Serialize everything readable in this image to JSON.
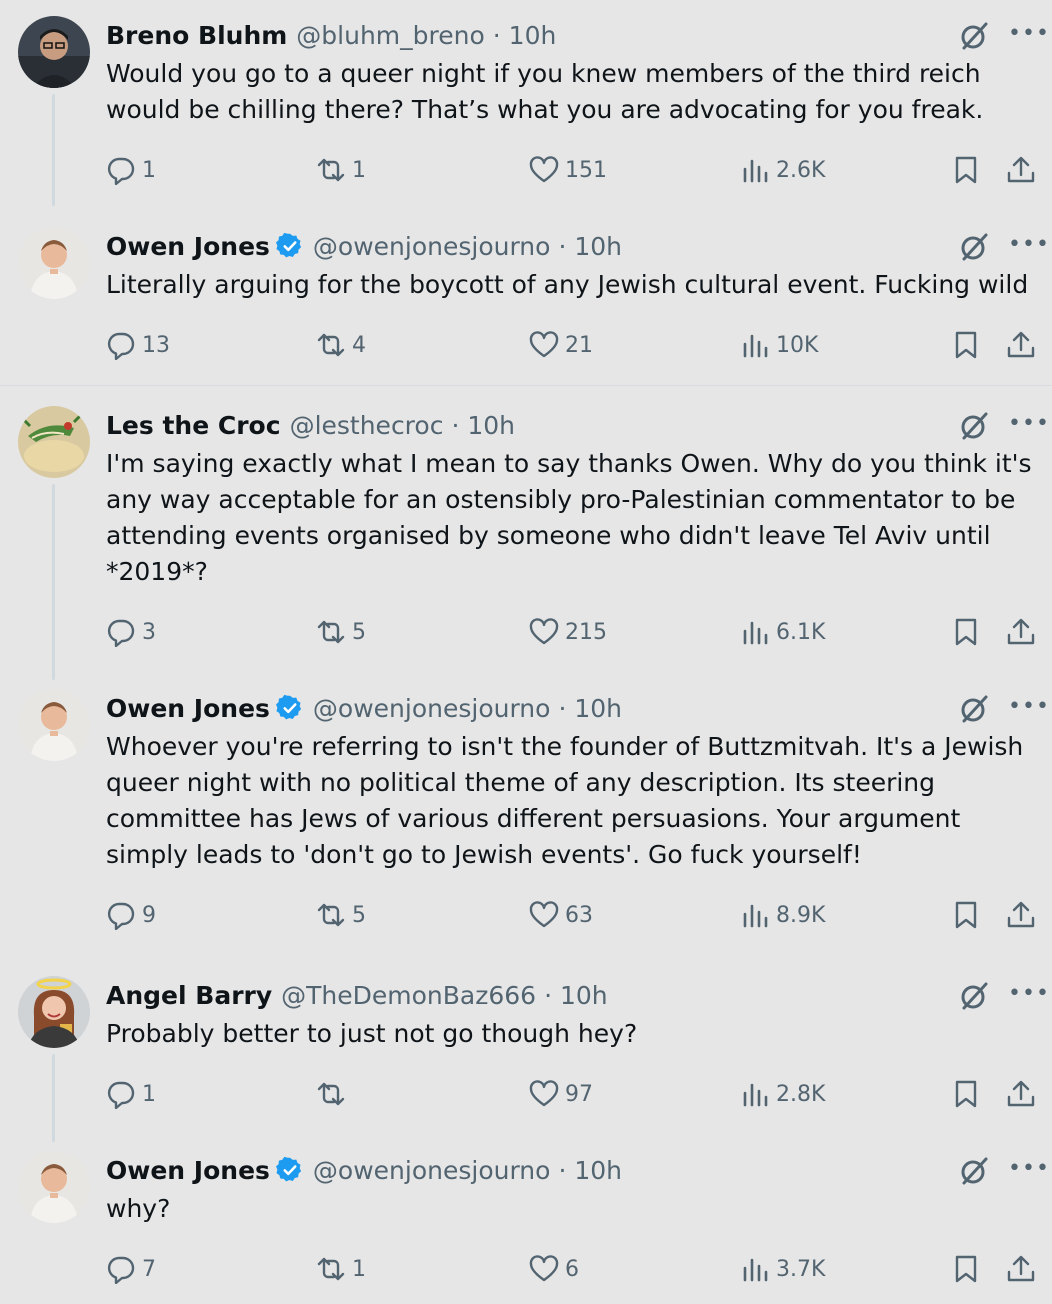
{
  "tweets": [
    {
      "name": "Breno Bluhm",
      "handle": "@bluhm_breno",
      "time": "· 10h",
      "verified": false,
      "avatar": "avatar-photo",
      "text": "Would you go to a queer night if you knew members of the third reich would be chilling there? That’s what you are advocating for you freak.",
      "replies": "1",
      "reposts": "1",
      "likes": "151",
      "views": "2.6K"
    },
    {
      "name": "Owen Jones",
      "handle": "@owenjonesjourno",
      "time": "· 10h",
      "verified": true,
      "avatar": "avatar-photo",
      "text": "Literally arguing for the boycott of any Jewish cultural event. Fucking wild",
      "replies": "13",
      "reposts": "4",
      "likes": "21",
      "views": "10K"
    },
    {
      "name": "Les the Croc",
      "handle": "@lesthecroc",
      "time": "· 10h",
      "verified": false,
      "avatar": "avatar-photo",
      "text": "I'm saying exactly what I mean to say thanks Owen. Why do you think it's any way acceptable for an ostensibly pro-Palestinian commentator to be attending events organised by someone who didn't leave Tel Aviv until *2019*?",
      "replies": "3",
      "reposts": "5",
      "likes": "215",
      "views": "6.1K"
    },
    {
      "name": "Owen Jones",
      "handle": "@owenjonesjourno",
      "time": "· 10h",
      "verified": true,
      "avatar": "avatar-photo",
      "text": "Whoever you're referring to isn't the founder of Buttzmitvah. It's a Jewish queer night with no political theme of any description. Its steering committee has Jews of various different persuasions. Your argument simply leads to 'don't go to Jewish events'. Go fuck yourself!",
      "replies": "9",
      "reposts": "5",
      "likes": "63",
      "views": "8.9K"
    },
    {
      "name": "Angel Barry",
      "handle": "@TheDemonBaz666",
      "time": "· 10h",
      "verified": false,
      "avatar": "avatar-photo",
      "text": "Probably better to just not go though hey?",
      "replies": "1",
      "reposts": "",
      "likes": "97",
      "views": "2.8K"
    },
    {
      "name": "Owen Jones",
      "handle": "@owenjonesjourno",
      "time": "· 10h",
      "verified": true,
      "avatar": "avatar-photo",
      "text": "why?",
      "replies": "7",
      "reposts": "1",
      "likes": "6",
      "views": "3.7K"
    }
  ],
  "icons": {
    "reply": "reply-icon",
    "repost": "repost-icon",
    "like": "heart-icon",
    "views": "views-icon",
    "bookmark": "bookmark-icon",
    "share": "share-icon",
    "grok": "grok-icon",
    "more": "more-icon",
    "verified": "verified-badge-icon"
  },
  "colors": {
    "background": "#e6e6e6",
    "text": "#0f1419",
    "secondary": "#536471",
    "verified": "#1d9bf0"
  }
}
